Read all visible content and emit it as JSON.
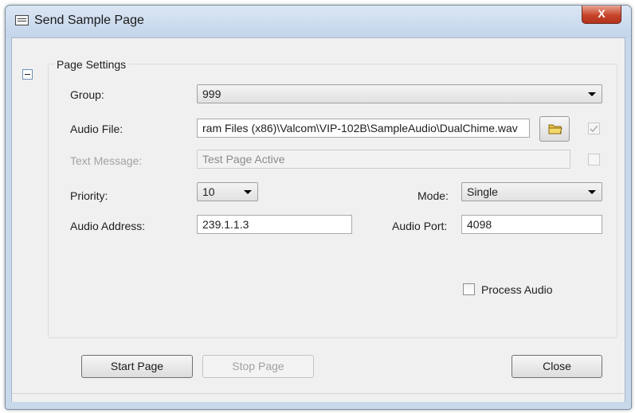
{
  "window": {
    "title": "Send Sample Page",
    "close_glyph": "X"
  },
  "panel": {
    "title": "Page Settings",
    "collapse_icon": "minus-box-icon"
  },
  "form": {
    "group_label": "Group:",
    "group_value": "999",
    "audio_file_label": "Audio File:",
    "audio_file_value": "ram Files (x86)\\Valcom\\VIP-102B\\SampleAudio\\DualChime.wav",
    "audio_file_checked": true,
    "text_message_label": "Text Message:",
    "text_message_value": "Test Page Active",
    "text_message_checked": false,
    "priority_label": "Priority:",
    "priority_value": "10",
    "mode_label": "Mode:",
    "mode_value": "Single",
    "audio_address_label": "Audio Address:",
    "audio_address_value": "239.1.1.3",
    "audio_port_label": "Audio Port:",
    "audio_port_value": "4098",
    "process_audio_label": "Process Audio",
    "process_audio_checked": false
  },
  "buttons": {
    "start": "Start Page",
    "stop": "Stop Page",
    "close": "Close"
  },
  "colors": {
    "close_button": "#c7452b",
    "title_bar": "#c9d9ec"
  }
}
